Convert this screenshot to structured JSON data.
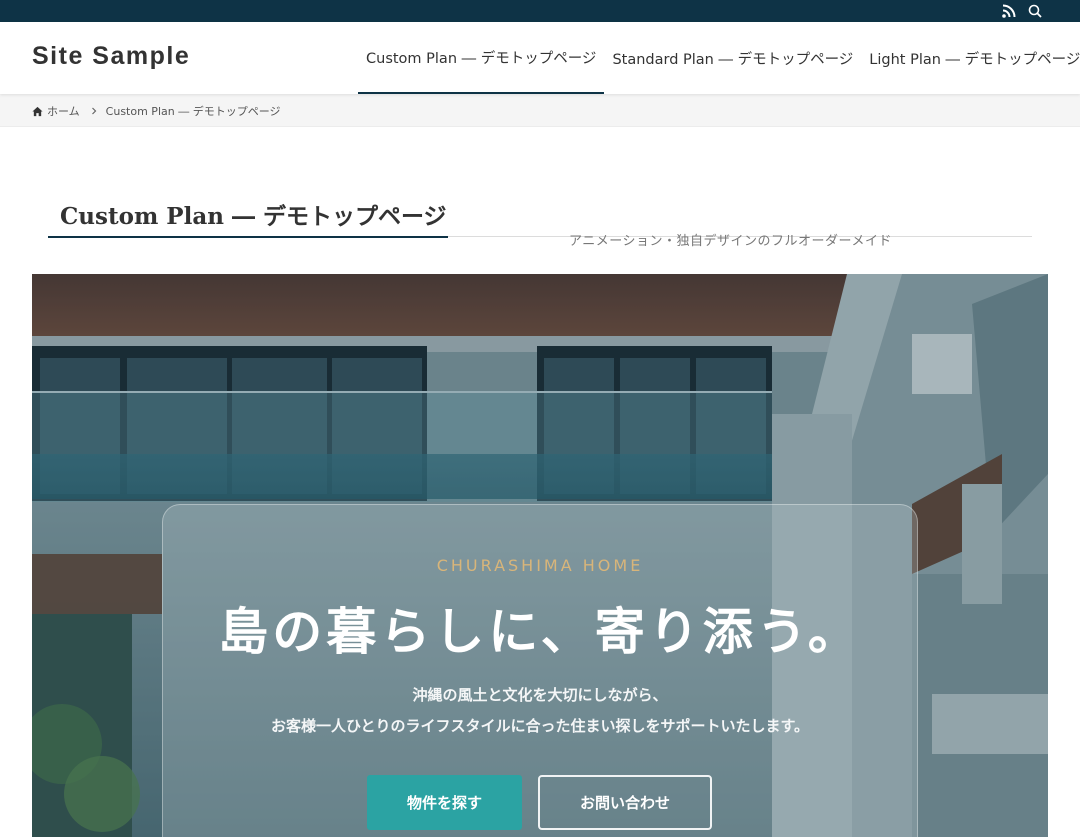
{
  "site": {
    "logo": "Site Sample"
  },
  "topbar": {
    "icons": [
      "rss-icon",
      "search-icon"
    ]
  },
  "nav": {
    "items": [
      {
        "label": "Custom Plan ― デモトップページ",
        "active": true
      },
      {
        "label": "Standard Plan ― デモトップページ",
        "active": false
      },
      {
        "label": "Light Plan ― デモトップページ",
        "active": false
      }
    ]
  },
  "breadcrumb": {
    "home": "ホーム",
    "current": "Custom Plan ― デモトップページ"
  },
  "page": {
    "title": "Custom Plan ― デモトップページ",
    "subtitle": "アニメーション・独自デザインのフルオーダーメイド"
  },
  "hero": {
    "eyebrow": "CHURASHIMA HOME",
    "headline": "島の暮らしに、寄り添う。",
    "desc_line1": "沖縄の風土と文化を大切にしながら、",
    "desc_line2": "お客様一人ひとりのライフスタイルに合った住まい探しをサポートいたします。",
    "primary_button": "物件を探す",
    "secondary_button": "お問い合わせ"
  },
  "colors": {
    "topbar": "#0e3346",
    "accent_teal": "#2ba3a3",
    "eyebrow_gold": "#d8b57a"
  }
}
